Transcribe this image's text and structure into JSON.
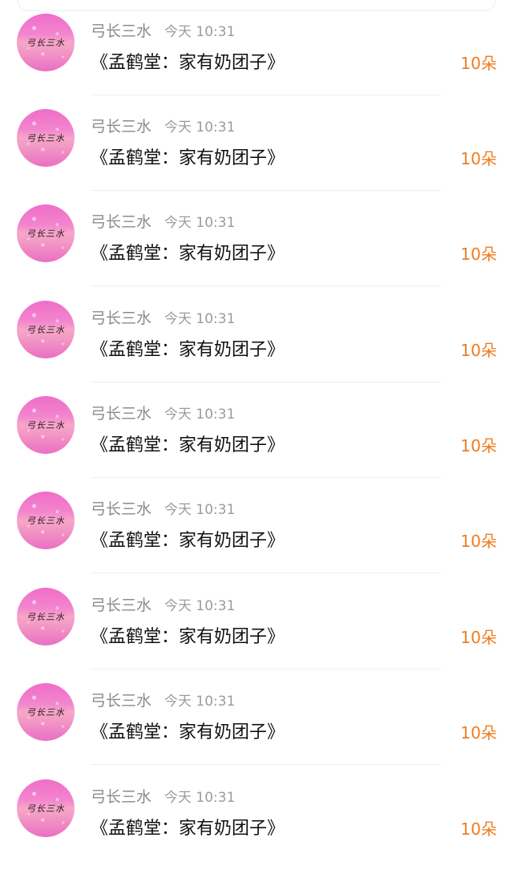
{
  "list": {
    "items": [
      {
        "avatar_text": "弓长三水",
        "username": "弓长三水",
        "time": "今天 10:31",
        "title": "《孟鹤堂：家有奶团子》",
        "amount": "10朵"
      },
      {
        "avatar_text": "弓长三水",
        "username": "弓长三水",
        "time": "今天 10:31",
        "title": "《孟鹤堂：家有奶团子》",
        "amount": "10朵"
      },
      {
        "avatar_text": "弓长三水",
        "username": "弓长三水",
        "time": "今天 10:31",
        "title": "《孟鹤堂：家有奶团子》",
        "amount": "10朵"
      },
      {
        "avatar_text": "弓长三水",
        "username": "弓长三水",
        "time": "今天 10:31",
        "title": "《孟鹤堂：家有奶团子》",
        "amount": "10朵"
      },
      {
        "avatar_text": "弓长三水",
        "username": "弓长三水",
        "time": "今天 10:31",
        "title": "《孟鹤堂：家有奶团子》",
        "amount": "10朵"
      },
      {
        "avatar_text": "弓长三水",
        "username": "弓长三水",
        "time": "今天 10:31",
        "title": "《孟鹤堂：家有奶团子》",
        "amount": "10朵"
      },
      {
        "avatar_text": "弓长三水",
        "username": "弓长三水",
        "time": "今天 10:31",
        "title": "《孟鹤堂：家有奶团子》",
        "amount": "10朵"
      },
      {
        "avatar_text": "弓长三水",
        "username": "弓长三水",
        "time": "今天 10:31",
        "title": "《孟鹤堂：家有奶团子》",
        "amount": "10朵"
      },
      {
        "avatar_text": "弓长三水",
        "username": "弓长三水",
        "time": "今天 10:31",
        "title": "《孟鹤堂：家有奶团子》",
        "amount": "10朵"
      }
    ]
  },
  "colors": {
    "amount": "#f07c1e",
    "username": "#8a8a8a",
    "title": "#111111",
    "avatar_gradient_top": "#f06ec8",
    "avatar_gradient_mid": "#f7a6c8"
  }
}
